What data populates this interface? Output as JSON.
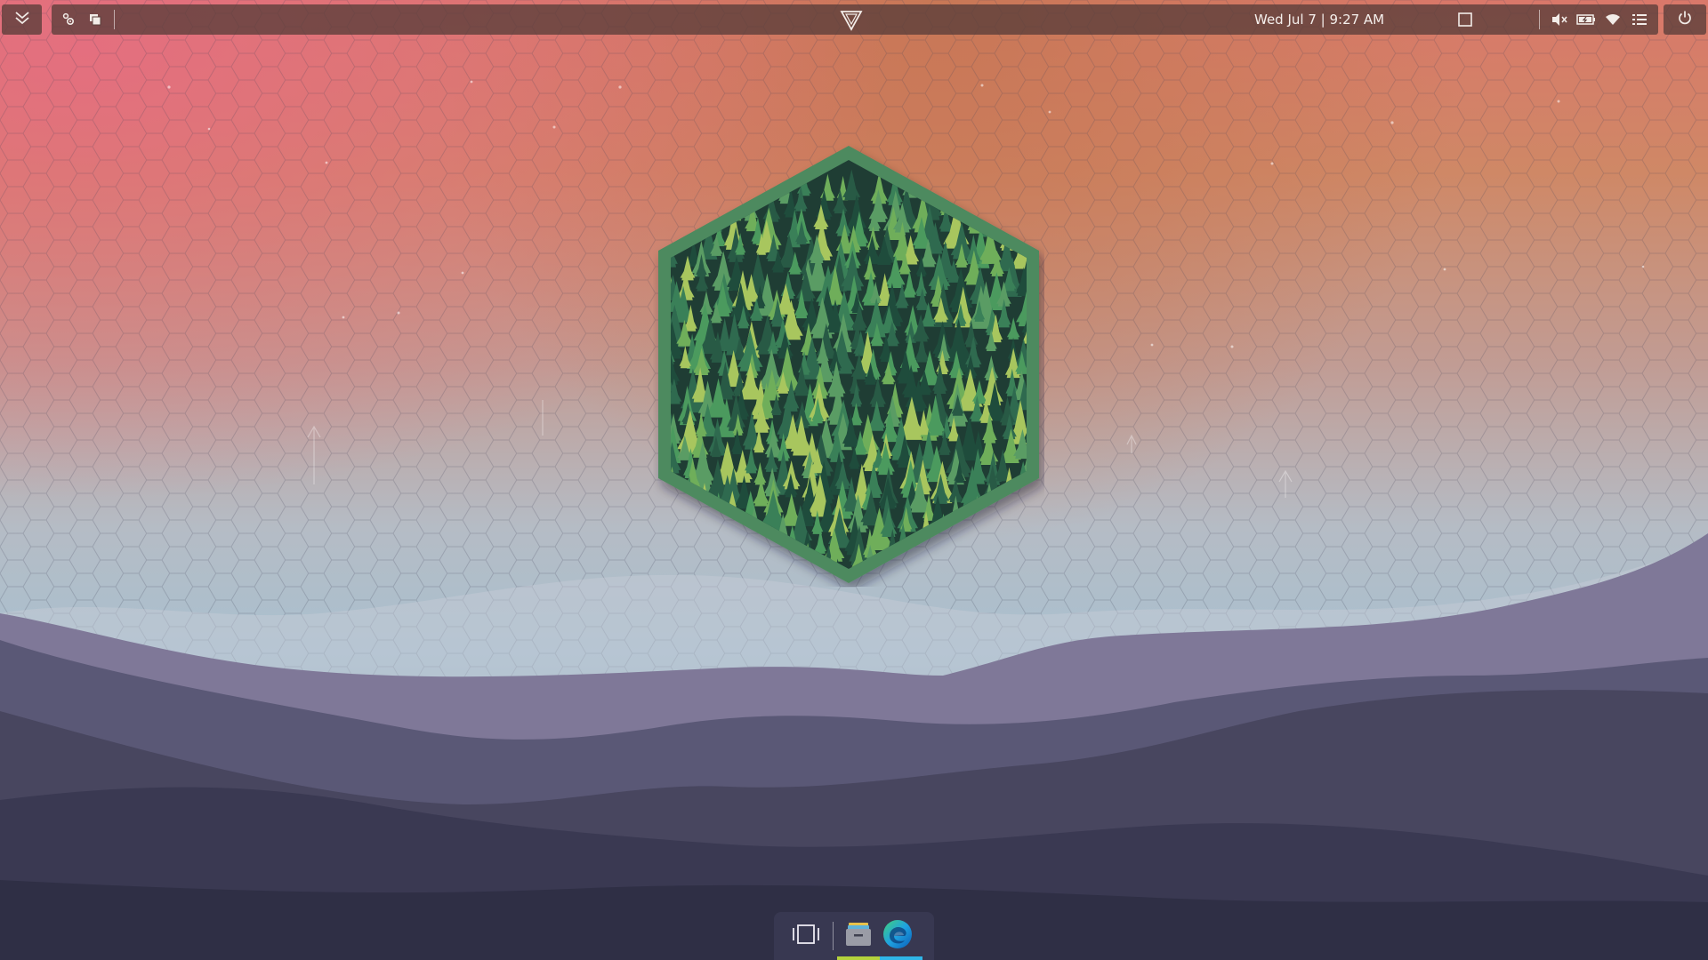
{
  "top_panel": {
    "clock_text": "Wed Jul 7 | 9:27 AM",
    "left_menu_icon": "chevron-double-down-icon",
    "left_apps": [
      {
        "name": "applications-menu",
        "icon": "apps-cog-icon"
      },
      {
        "name": "window-list",
        "icon": "windows-stack-icon"
      }
    ],
    "center_logo_icon": "triangle-logo-icon",
    "window_icon": "square-window-icon",
    "tray": [
      {
        "name": "volume",
        "icon": "volume-muted-icon"
      },
      {
        "name": "battery",
        "icon": "battery-charging-icon"
      },
      {
        "name": "wifi",
        "icon": "wifi-icon"
      },
      {
        "name": "notifications",
        "icon": "list-icon"
      }
    ],
    "power_icon": "power-icon",
    "bg_color": "#5a3e3a"
  },
  "dock": {
    "items": [
      {
        "name": "multitasking-view",
        "icon": "multitask-view-icon"
      },
      {
        "name": "files",
        "icon": "files-folder-icon",
        "indicator_color": "#b4d23c"
      },
      {
        "name": "edge-browser",
        "icon": "edge-browser-icon",
        "indicator_color": "#2fb6e8"
      }
    ]
  },
  "wallpaper": {
    "colors": {
      "sky_top_left": "#e46f7f",
      "sky_top_mid": "#c87856",
      "sky_bottom": "#a9c0cf",
      "mountain_far": "#7f7898",
      "mountain_mid": "#4d4a66",
      "mountain_near": "#34344b",
      "hex_frame": "#4e8a5e",
      "forest_dark": "#1f3d34"
    }
  }
}
